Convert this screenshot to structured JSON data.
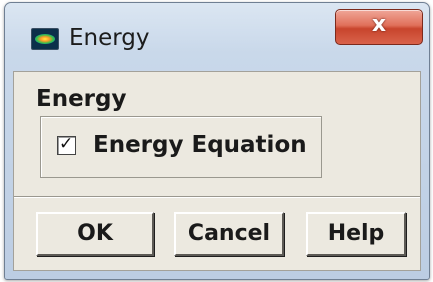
{
  "window": {
    "title": "Energy",
    "icon": "energy-contour-app-icon",
    "close_glyph": "x"
  },
  "group": {
    "label": "Energy",
    "checkbox": {
      "label": "Energy Equation",
      "checked": true,
      "check_glyph": "✓"
    }
  },
  "buttons": {
    "ok_label": "OK",
    "cancel_label": "Cancel",
    "help_label": "Help"
  },
  "colors": {
    "close_button": "#d9624a",
    "dialog_body": "#ece9e0"
  }
}
